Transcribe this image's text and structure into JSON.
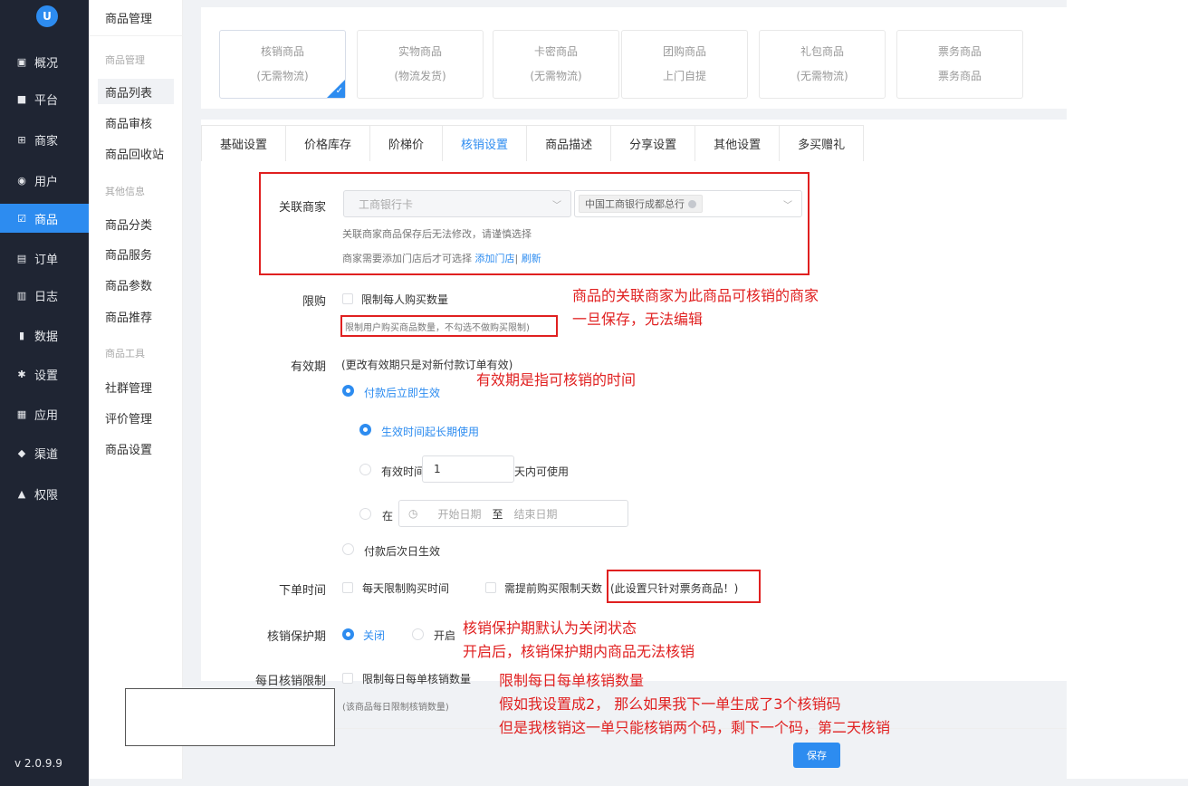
{
  "sidebar": {
    "logo": "U",
    "items": [
      {
        "label": "概况",
        "icon": "dashboard-icon",
        "glyph": "▣"
      },
      {
        "label": "平台",
        "icon": "platform-icon",
        "glyph": "■"
      },
      {
        "label": "商家",
        "icon": "store-icon",
        "glyph": "⊞"
      },
      {
        "label": "用户",
        "icon": "user-icon",
        "glyph": "◉"
      },
      {
        "label": "商品",
        "icon": "goods-icon",
        "glyph": "☑"
      },
      {
        "label": "订单",
        "icon": "order-icon",
        "glyph": "▤"
      },
      {
        "label": "日志",
        "icon": "log-icon",
        "glyph": "▥"
      },
      {
        "label": "数据",
        "icon": "chart-icon",
        "glyph": "▮"
      },
      {
        "label": "设置",
        "icon": "gear-icon",
        "glyph": "✱"
      },
      {
        "label": "应用",
        "icon": "apps-icon",
        "glyph": "▦"
      },
      {
        "label": "渠道",
        "icon": "channel-icon",
        "glyph": "◆"
      },
      {
        "label": "权限",
        "icon": "lock-icon",
        "glyph": "▲"
      }
    ],
    "version": "v 2.0.9.9"
  },
  "submenu": {
    "title": "商品管理",
    "group1": "商品管理",
    "items1": [
      "商品列表",
      "商品审核",
      "商品回收站"
    ],
    "group2": "其他信息",
    "items2": [
      "商品分类",
      "商品服务",
      "商品参数",
      "商品推荐"
    ],
    "group3": "商品工具",
    "items3": [
      "社群管理",
      "评价管理",
      "商品设置"
    ]
  },
  "product_types": [
    {
      "name": "核销商品",
      "sub": "(无需物流)"
    },
    {
      "name": "实物商品",
      "sub": "(物流发货)"
    },
    {
      "name": "卡密商品",
      "sub": "(无需物流)"
    },
    {
      "name": "团购商品",
      "sub": "上门自提"
    },
    {
      "name": "礼包商品",
      "sub": "(无需物流)"
    },
    {
      "name": "票务商品",
      "sub": "票务商品"
    }
  ],
  "tabs": [
    "基础设置",
    "价格库存",
    "阶梯价",
    "核销设置",
    "商品描述",
    "分享设置",
    "其他设置",
    "多买赠礼"
  ],
  "form": {
    "merchant_label": "关联商家",
    "merchant_select": "工商银行卡",
    "store_tag": "中国工商银行成都总行",
    "merchant_hint1": "关联商家商品保存后无法修改，请谨慎选择",
    "merchant_hint2": "商家需要添加门店后才可选择",
    "add_store_link": "添加门店",
    "sep": "|",
    "refresh_link": "刷新",
    "limit_label": "限购",
    "limit_checkbox": "限制每人购买数量",
    "limit_hint": "限制用户购买商品数量，不勾选不做购买限制)",
    "validity_label": "有效期",
    "validity_note": "(更改有效期只是对新付款订单有效)",
    "opt_immediate": "付款后立即生效",
    "opt_long": "生效时间起长期使用",
    "opt_days_prefix": "有效时间起",
    "days_value": "1",
    "opt_days_suffix": "天内可使用",
    "opt_at": "在",
    "start_date": "开始日期",
    "to": "至",
    "end_date": "结束日期",
    "opt_next_day": "付款后次日生效",
    "order_time_label": "下单时间",
    "daily_limit_time": "每天限制购买时间",
    "advance_days": "需提前购买限制天数",
    "ticket_only_note": "(此设置只针对票务商品！)",
    "protect_label": "核销保护期",
    "protect_off": "关闭",
    "protect_on": "开启",
    "daily_verify_label": "每日核销限制",
    "daily_verify_checkbox": "限制每日每单核销数量",
    "daily_verify_hint": "(该商品每日限制核销数量)",
    "save_button": "保存"
  },
  "annotations": {
    "merchant_1": "商品的关联商家为此商品可核销的商家",
    "merchant_2": "一旦保存，无法编辑",
    "validity": "有效期是指可核销的时间",
    "protect_1": "核销保护期默认为关闭状态",
    "protect_2": "开启后，核销保护期内商品无法核销",
    "daily_1": "限制每日每单核销数量",
    "daily_2": "假如我设置成2， 那么如果我下一单生成了3个核销码",
    "daily_3": "但是我核销这一单只能核销两个码，剩下一个码，第二天核销"
  },
  "colors": {
    "primary": "#2d8cf0",
    "sidebar": "#1f2533",
    "annotation": "#e02020"
  }
}
